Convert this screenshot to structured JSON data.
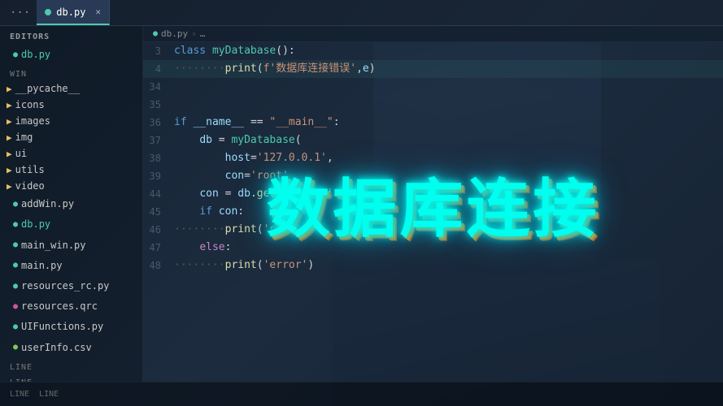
{
  "tabs": [
    {
      "id": "more",
      "label": "···",
      "active": false,
      "is_more": true
    },
    {
      "id": "db_py",
      "label": "db.py",
      "active": true,
      "has_dot": true,
      "closable": true
    }
  ],
  "breadcrumb": {
    "parts": [
      "db.py",
      ">",
      "..."
    ]
  },
  "sidebar": {
    "editors_title": "EDITORS",
    "editors_active": "db.py",
    "win_title": "WIN",
    "folders": [
      {
        "name": "__pycache__",
        "type": "folder"
      },
      {
        "name": "icons",
        "type": "folder"
      },
      {
        "name": "images",
        "type": "folder"
      },
      {
        "name": "img",
        "type": "folder"
      },
      {
        "name": "ui",
        "type": "folder"
      },
      {
        "name": "utils",
        "type": "folder"
      },
      {
        "name": "video",
        "type": "folder"
      }
    ],
    "files": [
      {
        "name": "addWin.py",
        "type": "py"
      },
      {
        "name": "db.py",
        "type": "py",
        "active": true
      },
      {
        "name": "main_win.py",
        "type": "py"
      },
      {
        "name": "main.py",
        "type": "py"
      },
      {
        "name": "resources_rc.py",
        "type": "py"
      },
      {
        "name": "resources.qrc",
        "type": "qrc"
      },
      {
        "name": "UIFunctions.py",
        "type": "py"
      },
      {
        "name": "userInfo.csv",
        "type": "csv"
      }
    ]
  },
  "bottom_bar": {
    "items": [
      "LINE",
      "LINE"
    ]
  },
  "overlay": {
    "title": "数据库连接"
  },
  "code": {
    "lines": [
      {
        "num": "3",
        "content": "class myDatabase():",
        "highlight": false
      },
      {
        "num": "4",
        "content": "········print(f'数据库连接错误',e)",
        "highlight": true
      },
      {
        "num": "34",
        "content": "",
        "highlight": false
      },
      {
        "num": "35",
        "content": "",
        "highlight": false
      },
      {
        "num": "36",
        "content": "if __name__ == \"__main__\":",
        "highlight": false
      },
      {
        "num": "37",
        "content": "    db = myDatabase(",
        "highlight": false
      },
      {
        "num": "38",
        "content": "        host='127.0.0.1',",
        "highlight": false
      },
      {
        "num": "39",
        "content": "        con='root'",
        "highlight": false
      },
      {
        "num": "44",
        "content": "    con = db.get_connection()",
        "highlight": false
      },
      {
        "num": "45",
        "content": "    if con:",
        "highlight": false
      },
      {
        "num": "46",
        "content": "········print('succ')",
        "highlight": false
      },
      {
        "num": "47",
        "content": "    else:",
        "highlight": false
      },
      {
        "num": "48",
        "content": "········print('error')",
        "highlight": false
      }
    ]
  }
}
